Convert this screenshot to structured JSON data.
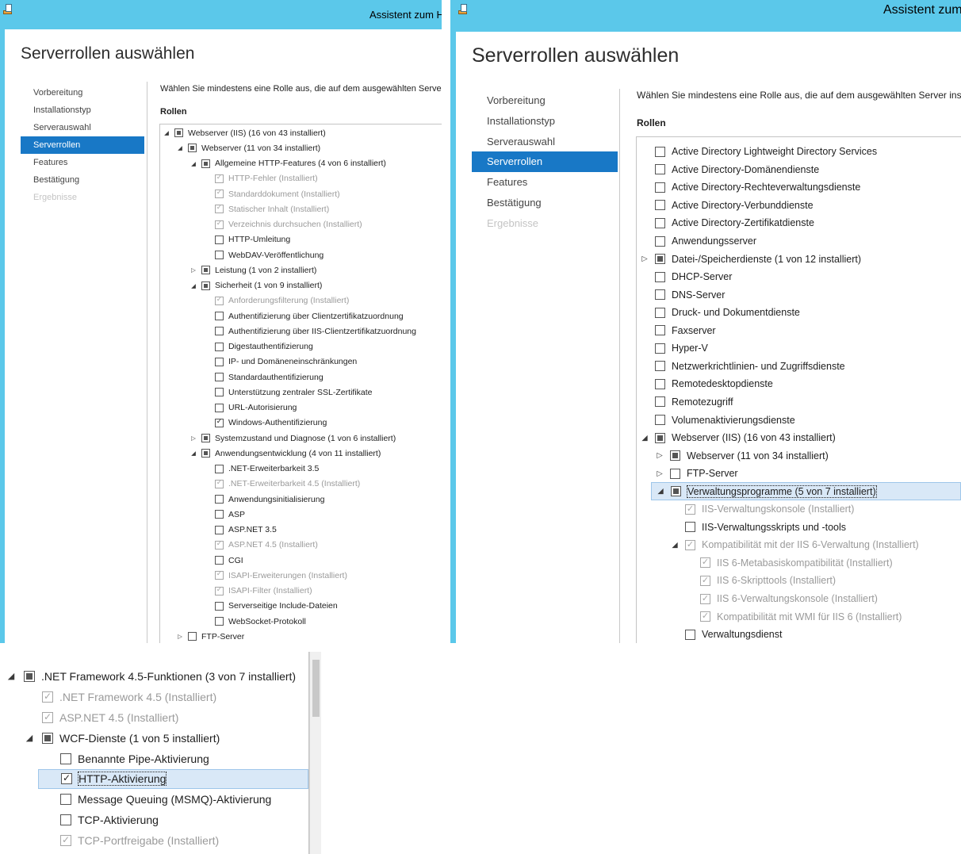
{
  "window_title": "Assistent zum Hinzufügen von Rollen und Features",
  "page_title": "Serverrollen auswählen",
  "nav": [
    {
      "label": "Vorbereitung",
      "state": "normal"
    },
    {
      "label": "Installationstyp",
      "state": "normal"
    },
    {
      "label": "Serverauswahl",
      "state": "normal"
    },
    {
      "label": "Serverrollen",
      "state": "active"
    },
    {
      "label": "Features",
      "state": "normal"
    },
    {
      "label": "Bestätigung",
      "state": "normal"
    },
    {
      "label": "Ergebnisse",
      "state": "disabled"
    }
  ],
  "description": "Wählen Sie mindestens eine Rolle aus, die auf dem ausgewählten Server installiert werden soll.",
  "roles_label": "Rollen",
  "colors": {
    "titlebar": "#5bc8ea",
    "nav_active": "#1878c6",
    "selection": "#1878c6",
    "installed_text": "#9a9a9a"
  },
  "panel1_tree": [
    {
      "level": 0,
      "exp": "open",
      "state": "partial",
      "label": "Webserver (IIS) (16 von 43 installiert)"
    },
    {
      "level": 1,
      "exp": "open",
      "state": "partial",
      "label": "Webserver (11 von 34 installiert)"
    },
    {
      "level": 2,
      "exp": "open",
      "state": "partial",
      "label": "Allgemeine HTTP-Features (4 von 6 installiert)"
    },
    {
      "level": 3,
      "exp": "none",
      "state": "installed",
      "label": "HTTP-Fehler (Installiert)"
    },
    {
      "level": 3,
      "exp": "none",
      "state": "installed",
      "label": "Standarddokument (Installiert)"
    },
    {
      "level": 3,
      "exp": "none",
      "state": "installed",
      "label": "Statischer Inhalt (Installiert)"
    },
    {
      "level": 3,
      "exp": "none",
      "state": "installed",
      "label": "Verzeichnis durchsuchen (Installiert)"
    },
    {
      "level": 3,
      "exp": "none",
      "state": "unchecked",
      "label": "HTTP-Umleitung"
    },
    {
      "level": 3,
      "exp": "none",
      "state": "unchecked",
      "label": "WebDAV-Veröffentlichung"
    },
    {
      "level": 2,
      "exp": "closed",
      "state": "partial",
      "label": "Leistung (1 von 2 installiert)"
    },
    {
      "level": 2,
      "exp": "open",
      "state": "partial",
      "label": "Sicherheit (1 von 9 installiert)"
    },
    {
      "level": 3,
      "exp": "none",
      "state": "installed",
      "label": "Anforderungsfilterung (Installiert)"
    },
    {
      "level": 3,
      "exp": "none",
      "state": "unchecked",
      "label": "Authentifizierung über Clientzertifikatzuordnung"
    },
    {
      "level": 3,
      "exp": "none",
      "state": "unchecked",
      "label": "Authentifizierung über IIS-Clientzertifikatzuordnung"
    },
    {
      "level": 3,
      "exp": "none",
      "state": "unchecked",
      "label": "Digestauthentifizierung"
    },
    {
      "level": 3,
      "exp": "none",
      "state": "unchecked",
      "label": "IP- und Domäneneinschränkungen"
    },
    {
      "level": 3,
      "exp": "none",
      "state": "unchecked",
      "label": "Standardauthentifizierung"
    },
    {
      "level": 3,
      "exp": "none",
      "state": "unchecked",
      "label": "Unterstützung zentraler SSL-Zertifikate"
    },
    {
      "level": 3,
      "exp": "none",
      "state": "unchecked",
      "label": "URL-Autorisierung"
    },
    {
      "level": 3,
      "exp": "none",
      "state": "checked",
      "label": "Windows-Authentifizierung"
    },
    {
      "level": 2,
      "exp": "closed",
      "state": "partial",
      "label": "Systemzustand und Diagnose (1 von 6 installiert)"
    },
    {
      "level": 2,
      "exp": "open",
      "state": "partial",
      "label": "Anwendungsentwicklung (4 von 11 installiert)"
    },
    {
      "level": 3,
      "exp": "none",
      "state": "unchecked",
      "label": ".NET-Erweiterbarkeit 3.5"
    },
    {
      "level": 3,
      "exp": "none",
      "state": "installed",
      "label": ".NET-Erweiterbarkeit 4.5 (Installiert)"
    },
    {
      "level": 3,
      "exp": "none",
      "state": "unchecked",
      "label": "Anwendungsinitialisierung"
    },
    {
      "level": 3,
      "exp": "none",
      "state": "unchecked",
      "label": "ASP"
    },
    {
      "level": 3,
      "exp": "none",
      "state": "unchecked",
      "label": "ASP.NET 3.5"
    },
    {
      "level": 3,
      "exp": "none",
      "state": "installed",
      "label": "ASP.NET 4.5 (Installiert)"
    },
    {
      "level": 3,
      "exp": "none",
      "state": "unchecked",
      "label": "CGI"
    },
    {
      "level": 3,
      "exp": "none",
      "state": "installed",
      "label": "ISAPI-Erweiterungen (Installiert)"
    },
    {
      "level": 3,
      "exp": "none",
      "state": "installed",
      "label": "ISAPI-Filter (Installiert)"
    },
    {
      "level": 3,
      "exp": "none",
      "state": "unchecked",
      "label": "Serverseitige Include-Dateien"
    },
    {
      "level": 3,
      "exp": "none",
      "state": "unchecked",
      "label": "WebSocket-Protokoll"
    },
    {
      "level": 1,
      "exp": "closed",
      "state": "unchecked",
      "label": "FTP-Server"
    }
  ],
  "panel2_tree": [
    {
      "level": 0,
      "exp": "none",
      "state": "unchecked",
      "label": "Active Directory Lightweight Directory Services"
    },
    {
      "level": 0,
      "exp": "none",
      "state": "unchecked",
      "label": "Active Directory-Domänendienste"
    },
    {
      "level": 0,
      "exp": "none",
      "state": "unchecked",
      "label": "Active Directory-Rechteverwaltungsdienste"
    },
    {
      "level": 0,
      "exp": "none",
      "state": "unchecked",
      "label": "Active Directory-Verbunddienste"
    },
    {
      "level": 0,
      "exp": "none",
      "state": "unchecked",
      "label": "Active Directory-Zertifikatdienste"
    },
    {
      "level": 0,
      "exp": "none",
      "state": "unchecked",
      "label": "Anwendungsserver"
    },
    {
      "level": 0,
      "exp": "closed",
      "state": "partial",
      "label": "Datei-/Speicherdienste (1 von 12 installiert)"
    },
    {
      "level": 0,
      "exp": "none",
      "state": "unchecked",
      "label": "DHCP-Server"
    },
    {
      "level": 0,
      "exp": "none",
      "state": "unchecked",
      "label": "DNS-Server"
    },
    {
      "level": 0,
      "exp": "none",
      "state": "unchecked",
      "label": "Druck- und Dokumentdienste"
    },
    {
      "level": 0,
      "exp": "none",
      "state": "unchecked",
      "label": "Faxserver"
    },
    {
      "level": 0,
      "exp": "none",
      "state": "unchecked",
      "label": "Hyper-V"
    },
    {
      "level": 0,
      "exp": "none",
      "state": "unchecked",
      "label": "Netzwerkrichtlinien- und Zugriffsdienste"
    },
    {
      "level": 0,
      "exp": "none",
      "state": "unchecked",
      "label": "Remotedesktopdienste"
    },
    {
      "level": 0,
      "exp": "none",
      "state": "unchecked",
      "label": "Remotezugriff"
    },
    {
      "level": 0,
      "exp": "none",
      "state": "unchecked",
      "label": "Volumenaktivierungsdienste"
    },
    {
      "level": 0,
      "exp": "open",
      "state": "partial",
      "label": "Webserver (IIS) (16 von 43 installiert)"
    },
    {
      "level": 1,
      "exp": "closed",
      "state": "partial",
      "label": "Webserver (11 von 34 installiert)"
    },
    {
      "level": 1,
      "exp": "closed",
      "state": "unchecked",
      "label": "FTP-Server"
    },
    {
      "level": 1,
      "exp": "open",
      "state": "partial",
      "label": "Verwaltungsprogramme (5 von 7 installiert)",
      "selected": true
    },
    {
      "level": 2,
      "exp": "none",
      "state": "installed",
      "label": "IIS-Verwaltungskonsole (Installiert)"
    },
    {
      "level": 2,
      "exp": "none",
      "state": "unchecked",
      "label": "IIS-Verwaltungsskripts und -tools"
    },
    {
      "level": 2,
      "exp": "open",
      "state": "installed",
      "label": "Kompatibilität mit der IIS 6-Verwaltung (Installiert)"
    },
    {
      "level": 3,
      "exp": "none",
      "state": "installed",
      "label": "IIS 6-Metabasiskompatibilität (Installiert)"
    },
    {
      "level": 3,
      "exp": "none",
      "state": "installed",
      "label": "IIS 6-Skripttools (Installiert)"
    },
    {
      "level": 3,
      "exp": "none",
      "state": "installed",
      "label": "IIS 6-Verwaltungskonsole (Installiert)"
    },
    {
      "level": 3,
      "exp": "none",
      "state": "installed",
      "label": "Kompatibilität mit WMI für IIS 6 (Installiert)"
    },
    {
      "level": 2,
      "exp": "none",
      "state": "unchecked",
      "label": "Verwaltungsdienst"
    }
  ],
  "panel3_tree": [
    {
      "level": 0,
      "exp": "open",
      "state": "partial",
      "label": ".NET Framework 4.5-Funktionen (3 von 7 installiert)"
    },
    {
      "level": 1,
      "exp": "none",
      "state": "installed",
      "label": ".NET Framework 4.5 (Installiert)"
    },
    {
      "level": 1,
      "exp": "none",
      "state": "installed",
      "label": "ASP.NET 4.5 (Installiert)"
    },
    {
      "level": 1,
      "exp": "open",
      "state": "partial",
      "label": "WCF-Dienste (1 von 5 installiert)"
    },
    {
      "level": 2,
      "exp": "none",
      "state": "unchecked",
      "label": "Benannte Pipe-Aktivierung"
    },
    {
      "level": 2,
      "exp": "none",
      "state": "checked",
      "label": "HTTP-Aktivierung",
      "selected": true
    },
    {
      "level": 2,
      "exp": "none",
      "state": "unchecked",
      "label": "Message Queuing (MSMQ)-Aktivierung"
    },
    {
      "level": 2,
      "exp": "none",
      "state": "unchecked",
      "label": "TCP-Aktivierung"
    },
    {
      "level": 2,
      "exp": "none",
      "state": "installed",
      "label": "TCP-Portfreigabe (Installiert)"
    }
  ]
}
